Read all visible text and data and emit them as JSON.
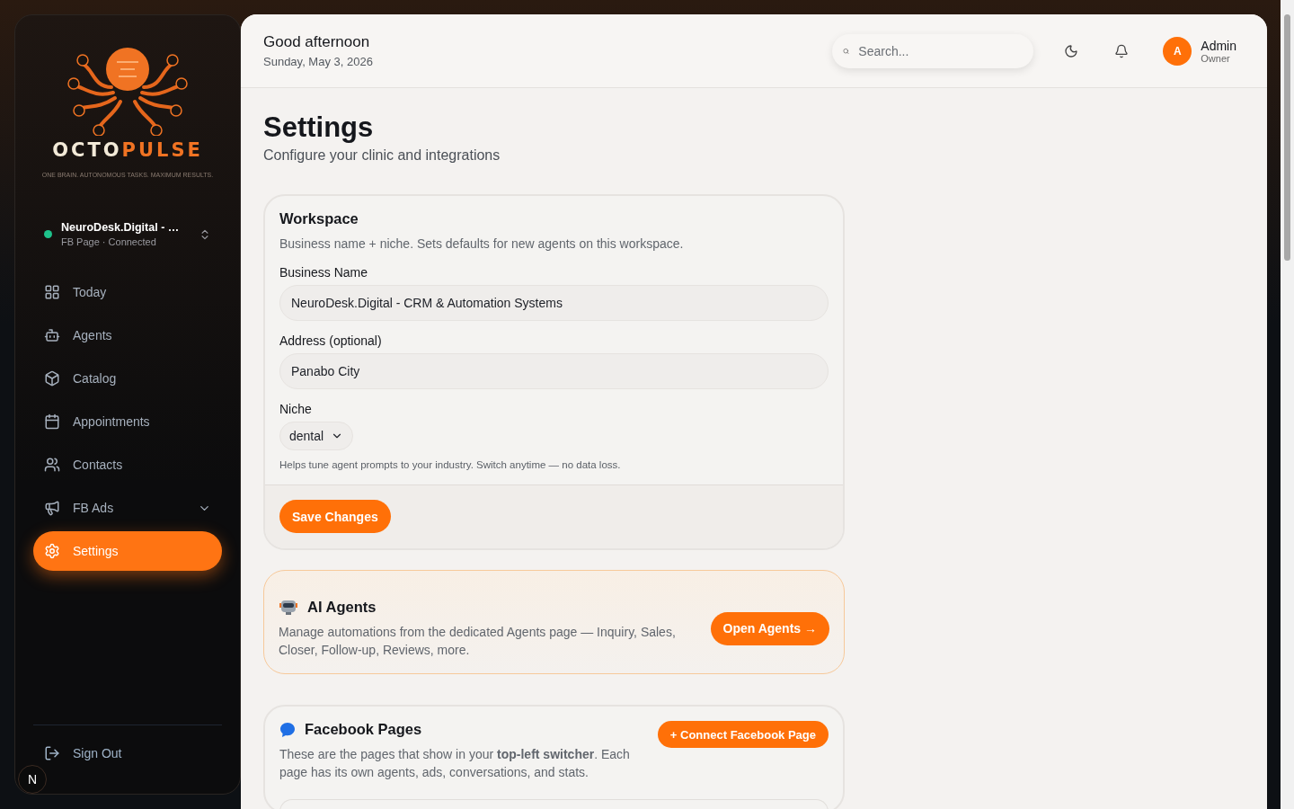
{
  "logo": {
    "name_left": "OCTO",
    "name_right": "PULSE",
    "tagline": "ONE BRAIN. AUTONOMOUS TASKS. MAXIMUM RESULTS."
  },
  "page_switcher": {
    "name": "NeuroDesk.Digital - …",
    "status": "FB Page · Connected",
    "connected": true
  },
  "nav": [
    {
      "label": "Today",
      "selected": false
    },
    {
      "label": "Agents",
      "selected": false
    },
    {
      "label": "Catalog",
      "selected": false
    },
    {
      "label": "Appointments",
      "selected": false
    },
    {
      "label": "Contacts",
      "selected": false
    },
    {
      "label": "FB Ads",
      "selected": false,
      "expandable": true
    },
    {
      "label": "Settings",
      "selected": true
    }
  ],
  "sign_out": "Sign Out",
  "dev_badge": "N",
  "header": {
    "greeting": "Good afternoon",
    "date": "Sunday, May 3, 2026",
    "search_placeholder": "Search...",
    "user": {
      "initial": "A",
      "name": "Admin",
      "role": "Owner"
    }
  },
  "title": "Settings",
  "subtitle": "Configure your clinic and integrations",
  "workspace": {
    "title": "Workspace",
    "description": "Business name + niche. Sets defaults for new agents on this workspace.",
    "fields": [
      {
        "label": "Business Name",
        "value": "NeuroDesk.Digital - CRM & Automation Systems"
      },
      {
        "label": "Address (optional)",
        "value": "Panabo City"
      }
    ],
    "niche": {
      "label": "Niche",
      "value": "dental",
      "help": "Helps tune agent prompts to your industry. Switch anytime — no data loss."
    },
    "save": "Save Changes"
  },
  "ai_agents": {
    "title": "AI Agents",
    "description": "Manage automations from the dedicated Agents page — Inquiry, Sales, Closer, Follow-up, Reviews, more.",
    "button": "Open Agents →"
  },
  "facebook": {
    "title": "Facebook Pages",
    "description": "These are the pages that show in your **top-left switcher**. Each page has its own agents, ads, conversations, and stats.",
    "button": "+ Connect Facebook Page"
  }
}
